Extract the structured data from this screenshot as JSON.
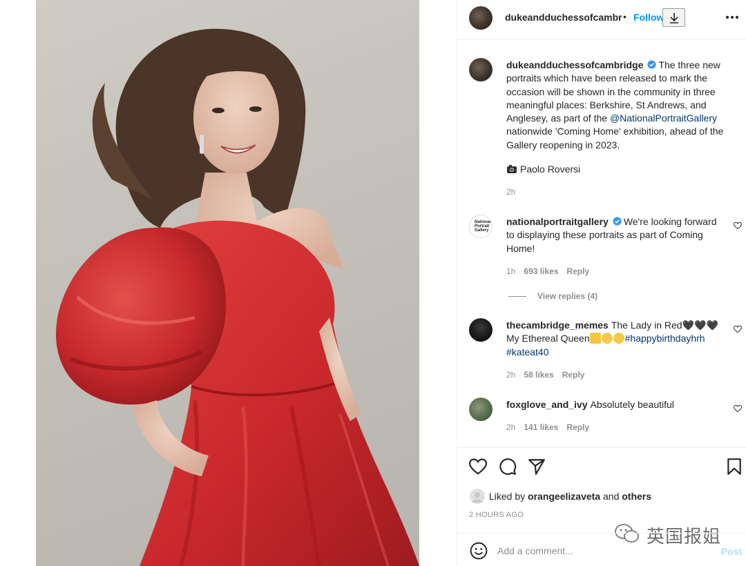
{
  "photo": {
    "alt_subject": "portrait-photo"
  },
  "header": {
    "username": "dukeandduchessofcambri",
    "separator": "•",
    "follow_label": "Follow",
    "download_icon": "download-icon",
    "more_icon": "more-options-icon"
  },
  "caption": {
    "username": "dukeandduchessofcambridge",
    "text_before": "The three new portraits which have been released to mark the occasion will be shown in the community in three meaningful places: Berkshire, St Andrews, and Anglesey, as part of the",
    "mention": "@NationalPortraitGallery",
    "text_after": "nationwide 'Coming Home' exhibition, ahead of the Gallery reopening in 2023.",
    "credit_icon": "camera-emoji",
    "credit": "Paolo Roversi",
    "time": "2h"
  },
  "comments": [
    {
      "username": "nationalportraitgallery",
      "avatar_text": "National Portrait Gallery",
      "text": "We're looking forward to displaying these portraits as part of Coming Home!",
      "time": "1h",
      "likes": "693 likes",
      "reply_label": "Reply",
      "view_replies": "View replies (4)"
    },
    {
      "username": "thecambridge_memes",
      "text_before": "The Lady in Red🖤🖤🖤 My Ethereal Queen",
      "hashtag1": "#happybirthdayhrh",
      "hashtag2": "#kateat40",
      "time": "2h",
      "likes": "58 likes",
      "reply_label": "Reply"
    },
    {
      "username": "foxglove_and_ivy",
      "text": "Absolutely beautiful",
      "time": "2h",
      "likes": "141 likes",
      "reply_label": "Reply"
    }
  ],
  "actions": {
    "like_icon": "heart-icon",
    "comment_icon": "comment-icon",
    "share_icon": "share-icon",
    "save_icon": "bookmark-icon",
    "liked_by_prefix": "Liked by",
    "liked_by_user": "orangeelizaveta",
    "liked_by_and": "and",
    "liked_by_others": "others",
    "time_ago": "2 HOURS AGO"
  },
  "add_comment": {
    "placeholder": "Add a comment...",
    "post_label": "Post"
  },
  "watermark": "英国报姐",
  "colors": {
    "accent": "#0095f6",
    "link": "#00376b",
    "muted": "#8e8e8e",
    "post_disabled": "#b2dffc",
    "dress_red": "#c8282b"
  }
}
